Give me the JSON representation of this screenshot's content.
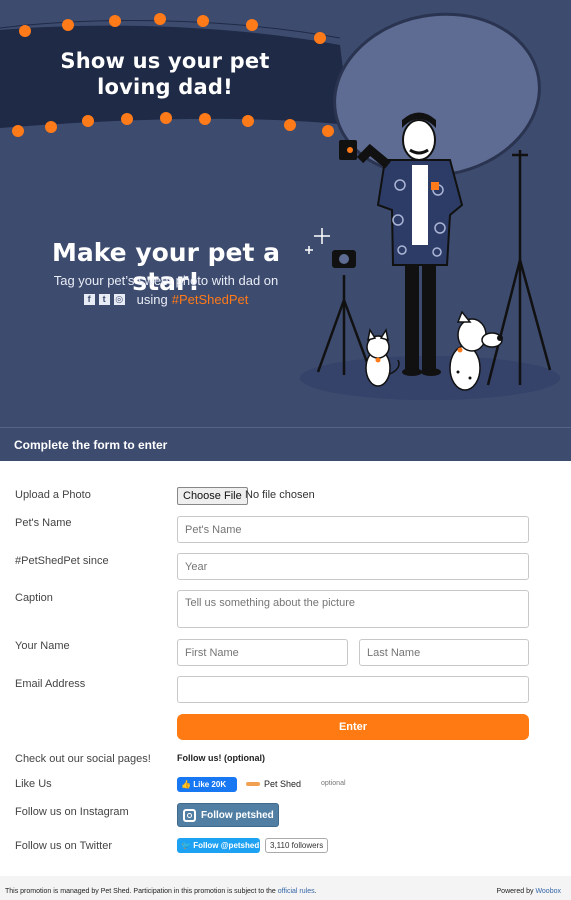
{
  "hero": {
    "banner_text": "Show us your pet loving dad!",
    "headline": "Make your pet a star!",
    "subline": "Tag your pet’s sweet photo with dad on",
    "using_text": "using",
    "hashtag": "#PetShedPet",
    "social_icons": [
      "facebook-icon",
      "twitter-icon",
      "instagram-icon"
    ]
  },
  "form": {
    "header": "Complete the form to enter",
    "upload_label": "Upload a Photo",
    "choose_file_label": "Choose File",
    "file_status": "No file chosen",
    "pet_name_label": "Pet's Name",
    "pet_name_placeholder": "Pet's Name",
    "since_label": "#PetShedPet since",
    "since_placeholder": "Year",
    "caption_label": "Caption",
    "caption_placeholder": "Tell us something about the picture",
    "your_name_label": "Your Name",
    "first_name_placeholder": "First Name",
    "last_name_placeholder": "Last Name",
    "email_label": "Email Address",
    "email_placeholder": "",
    "enter_label": "Enter"
  },
  "social": {
    "check_out_label": "Check out our social pages!",
    "follow_us_label": "Follow us! (optional)",
    "like_label": "Like Us",
    "fb_like_text": "Like 20K",
    "page_name": "Pet Shed",
    "optional_text": "optional",
    "instagram_label": "Follow us on Instagram",
    "instagram_button": "Follow petshed",
    "twitter_label": "Follow us on Twitter",
    "twitter_button": "Follow @petshed",
    "twitter_followers": "3,110 followers"
  },
  "footer": {
    "managed_text": "This promotion is managed by Pet Shed. Participation in this promotion is subject to the",
    "rules_link": "official rules",
    "powered_text": "Powered by",
    "powered_link": "Woobox"
  },
  "colors": {
    "hero_bg": "#3d4b6f",
    "accent_orange": "#ff7a12",
    "facebook_blue": "#1877f2",
    "instagram_blue": "#517fa4",
    "twitter_blue": "#1da1f2"
  }
}
